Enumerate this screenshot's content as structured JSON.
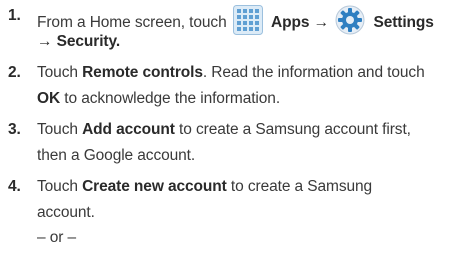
{
  "steps": [
    {
      "num": "1.",
      "l1_a": "From a Home screen, touch",
      "apps_icon": "apps-grid-icon",
      "l1_apps": "Apps",
      "arrow1": "→",
      "settings_icon": "settings-gear-icon",
      "l1_settings": "Settings",
      "l2_arrow": "→",
      "l2_security": "Security",
      "l2_end": "."
    },
    {
      "num": "2.",
      "l1_a": "Touch ",
      "l1_b": "Remote controls",
      "l1_c": ". Read the information and touch",
      "l2_b": "OK",
      "l2_c": " to acknowledge the information."
    },
    {
      "num": "3.",
      "l1_a": "Touch ",
      "l1_b": "Add account",
      "l1_c": " to create a Samsung account first,",
      "l2": "then a Google account."
    },
    {
      "num": "4.",
      "l1_a": "Touch ",
      "l1_b": "Create new account",
      "l1_c": " to create a Samsung",
      "l2": "account.",
      "l3": "– or –"
    }
  ],
  "colors": {
    "text": "#3a3a3a",
    "icon_blue": "#2f7fc1"
  }
}
